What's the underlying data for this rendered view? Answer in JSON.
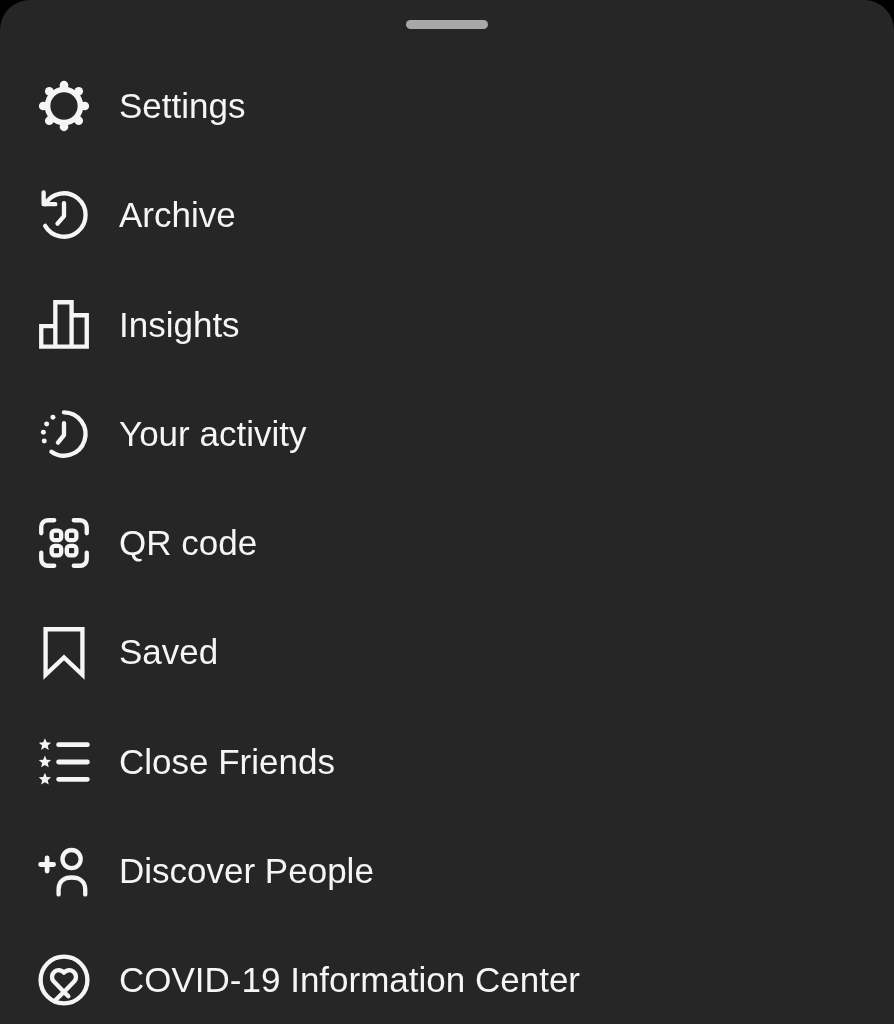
{
  "menu": {
    "items": [
      {
        "kind": "settings",
        "label": "Settings"
      },
      {
        "kind": "archive",
        "label": "Archive"
      },
      {
        "kind": "insights",
        "label": "Insights"
      },
      {
        "kind": "activity",
        "label": "Your activity"
      },
      {
        "kind": "qr",
        "label": "QR code"
      },
      {
        "kind": "saved",
        "label": "Saved"
      },
      {
        "kind": "close_friends",
        "label": "Close Friends"
      },
      {
        "kind": "discover",
        "label": "Discover People"
      },
      {
        "kind": "covid",
        "label": "COVID-19 Information Center"
      }
    ]
  }
}
